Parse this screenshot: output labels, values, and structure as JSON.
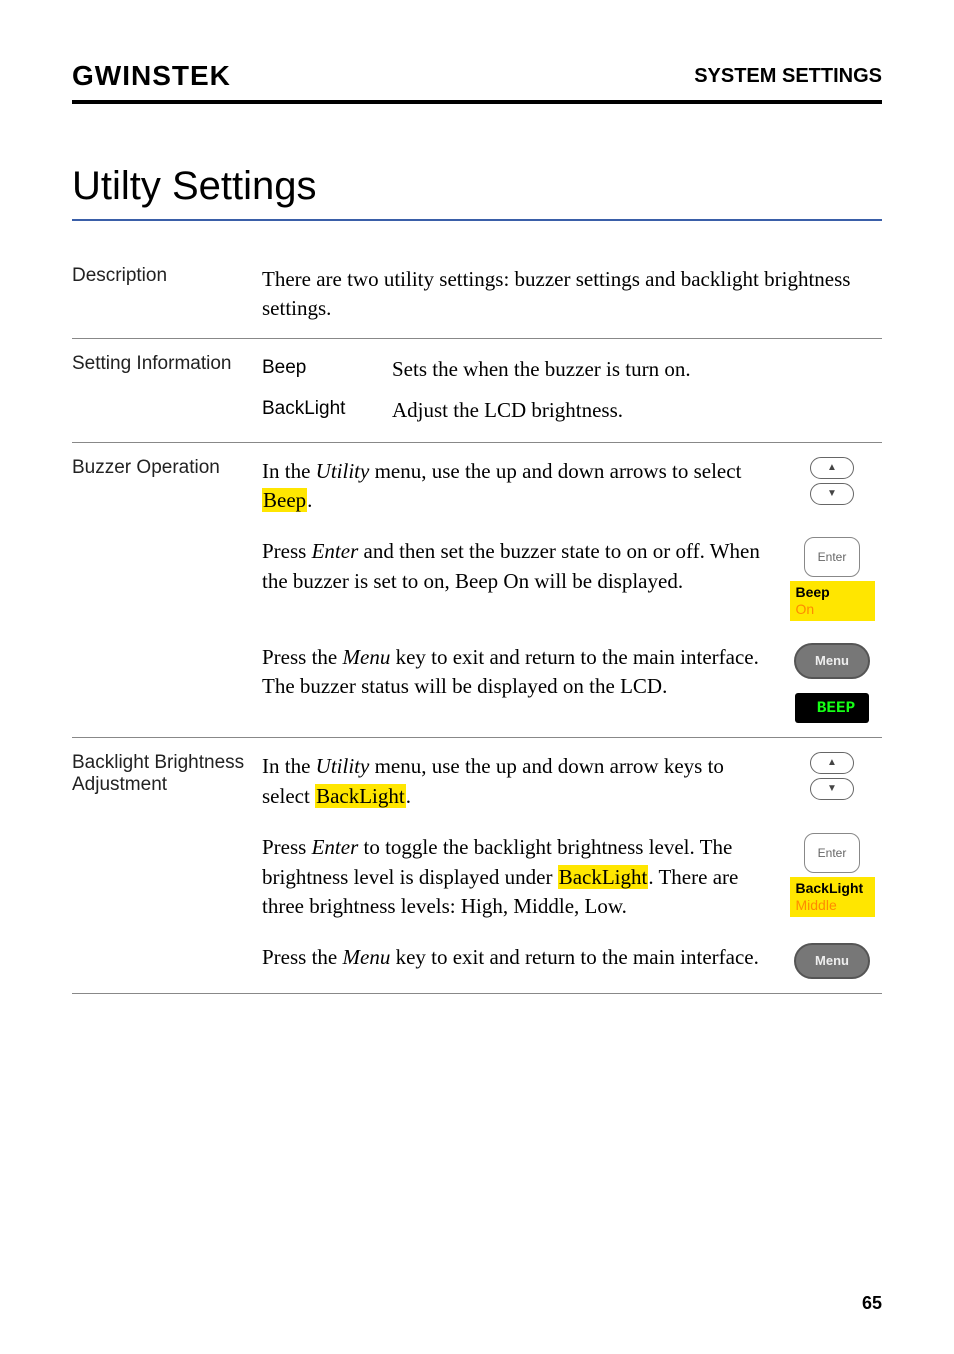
{
  "header": {
    "logo": "GWINSTEK",
    "section": "SYSTEM SETTINGS"
  },
  "title": "Utilty Settings",
  "description": {
    "label": "Description",
    "text": "There are two utility settings: buzzer settings and backlight brightness settings."
  },
  "setting_info": {
    "label": "Setting Information",
    "rows": [
      {
        "name": "Beep",
        "desc": "Sets the when the buzzer is turn on."
      },
      {
        "name": "BackLight",
        "desc": "Adjust the LCD brightness."
      }
    ]
  },
  "buzzer": {
    "label": "Buzzer Operation",
    "step1_a": "In the ",
    "step1_italic": "Utility",
    "step1_b": " menu, use the up and down arrows to select ",
    "step1_hl": "Beep",
    "step1_c": ".",
    "step2_a": "Press ",
    "step2_italic": "Enter",
    "step2_b": " and then set the buzzer state to on or off. When the buzzer is set to on, Beep On will be displayed.",
    "enter_label": "Enter",
    "chip_beep": "Beep",
    "chip_on": "On",
    "step3_a": "Press the ",
    "step3_italic": "Menu",
    "step3_b": " key to exit and return to the main interface. The buzzer status will be displayed on the LCD.",
    "menu_label": "Menu",
    "lcd_beep": "BEEP"
  },
  "backlight": {
    "label": "Backlight Brightness Adjustment",
    "step1_a": "In the ",
    "step1_italic": "Utility",
    "step1_b": " menu, use the up and down arrow keys to select ",
    "step1_hl": "BackLight",
    "step1_c": ".",
    "step2_a": "Press ",
    "step2_italic": "Enter",
    "step2_b": " to toggle the backlight brightness level. The brightness level is displayed under ",
    "step2_hl": "BackLight",
    "step2_c": ". There are three brightness levels: High, Middle, Low.",
    "enter_label": "Enter",
    "chip_bl": "BackLight",
    "chip_mid": "Middle",
    "step3_a": "Press the ",
    "step3_italic": "Menu",
    "step3_b": " key to exit and return to the main interface.",
    "menu_label": "Menu"
  },
  "page": "65"
}
